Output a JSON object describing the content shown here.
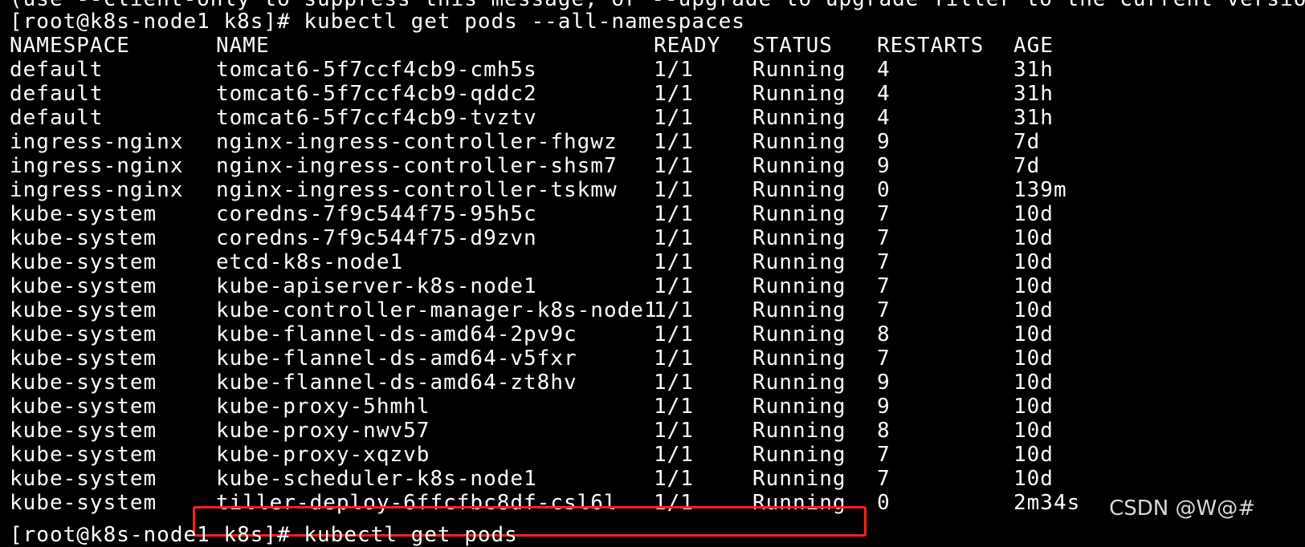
{
  "terminal": {
    "background": "#000000",
    "foreground": "#ffffff",
    "top_cut_line": "(use --client-only to suppress this message, or --upgrade to upgrade Tiller to the current version.)",
    "prompt_line": "[root@k8s-node1 k8s]# kubectl get pods --all-namespaces",
    "bottom_cut_line": "[root@k8s-node1 k8s]# kubectl get pods",
    "header": {
      "namespace": "NAMESPACE",
      "name": "NAME",
      "ready": "READY",
      "status": "STATUS",
      "restarts": "RESTARTS",
      "age": "AGE"
    },
    "rows": [
      {
        "namespace": "default",
        "name": "tomcat6-5f7ccf4cb9-cmh5s",
        "ready": "1/1",
        "status": "Running",
        "restarts": "4",
        "age": "31h"
      },
      {
        "namespace": "default",
        "name": "tomcat6-5f7ccf4cb9-qddc2",
        "ready": "1/1",
        "status": "Running",
        "restarts": "4",
        "age": "31h"
      },
      {
        "namespace": "default",
        "name": "tomcat6-5f7ccf4cb9-tvztv",
        "ready": "1/1",
        "status": "Running",
        "restarts": "4",
        "age": "31h"
      },
      {
        "namespace": "ingress-nginx",
        "name": "nginx-ingress-controller-fhgwz",
        "ready": "1/1",
        "status": "Running",
        "restarts": "9",
        "age": "7d"
      },
      {
        "namespace": "ingress-nginx",
        "name": "nginx-ingress-controller-shsm7",
        "ready": "1/1",
        "status": "Running",
        "restarts": "9",
        "age": "7d"
      },
      {
        "namespace": "ingress-nginx",
        "name": "nginx-ingress-controller-tskmw",
        "ready": "1/1",
        "status": "Running",
        "restarts": "0",
        "age": "139m"
      },
      {
        "namespace": "kube-system",
        "name": "coredns-7f9c544f75-95h5c",
        "ready": "1/1",
        "status": "Running",
        "restarts": "7",
        "age": "10d"
      },
      {
        "namespace": "kube-system",
        "name": "coredns-7f9c544f75-d9zvn",
        "ready": "1/1",
        "status": "Running",
        "restarts": "7",
        "age": "10d"
      },
      {
        "namespace": "kube-system",
        "name": "etcd-k8s-node1",
        "ready": "1/1",
        "status": "Running",
        "restarts": "7",
        "age": "10d"
      },
      {
        "namespace": "kube-system",
        "name": "kube-apiserver-k8s-node1",
        "ready": "1/1",
        "status": "Running",
        "restarts": "7",
        "age": "10d"
      },
      {
        "namespace": "kube-system",
        "name": "kube-controller-manager-k8s-node1",
        "ready": "1/1",
        "status": "Running",
        "restarts": "7",
        "age": "10d"
      },
      {
        "namespace": "kube-system",
        "name": "kube-flannel-ds-amd64-2pv9c",
        "ready": "1/1",
        "status": "Running",
        "restarts": "8",
        "age": "10d"
      },
      {
        "namespace": "kube-system",
        "name": "kube-flannel-ds-amd64-v5fxr",
        "ready": "1/1",
        "status": "Running",
        "restarts": "7",
        "age": "10d"
      },
      {
        "namespace": "kube-system",
        "name": "kube-flannel-ds-amd64-zt8hv",
        "ready": "1/1",
        "status": "Running",
        "restarts": "9",
        "age": "10d"
      },
      {
        "namespace": "kube-system",
        "name": "kube-proxy-5hmhl",
        "ready": "1/1",
        "status": "Running",
        "restarts": "9",
        "age": "10d"
      },
      {
        "namespace": "kube-system",
        "name": "kube-proxy-nwv57",
        "ready": "1/1",
        "status": "Running",
        "restarts": "8",
        "age": "10d"
      },
      {
        "namespace": "kube-system",
        "name": "kube-proxy-xqzvb",
        "ready": "1/1",
        "status": "Running",
        "restarts": "7",
        "age": "10d"
      },
      {
        "namespace": "kube-system",
        "name": "kube-scheduler-k8s-node1",
        "ready": "1/1",
        "status": "Running",
        "restarts": "7",
        "age": "10d"
      },
      {
        "namespace": "kube-system",
        "name": "tiller-deploy-6ffcfbc8df-csl6l",
        "ready": "1/1",
        "status": "Running",
        "restarts": "0",
        "age": "2m34s"
      }
    ],
    "highlighted_row": "tiller-deploy-6ffcfbc8df-csl6l",
    "highlight_color": "#ff2020"
  },
  "watermark": {
    "text": "CSDN @W@#"
  }
}
